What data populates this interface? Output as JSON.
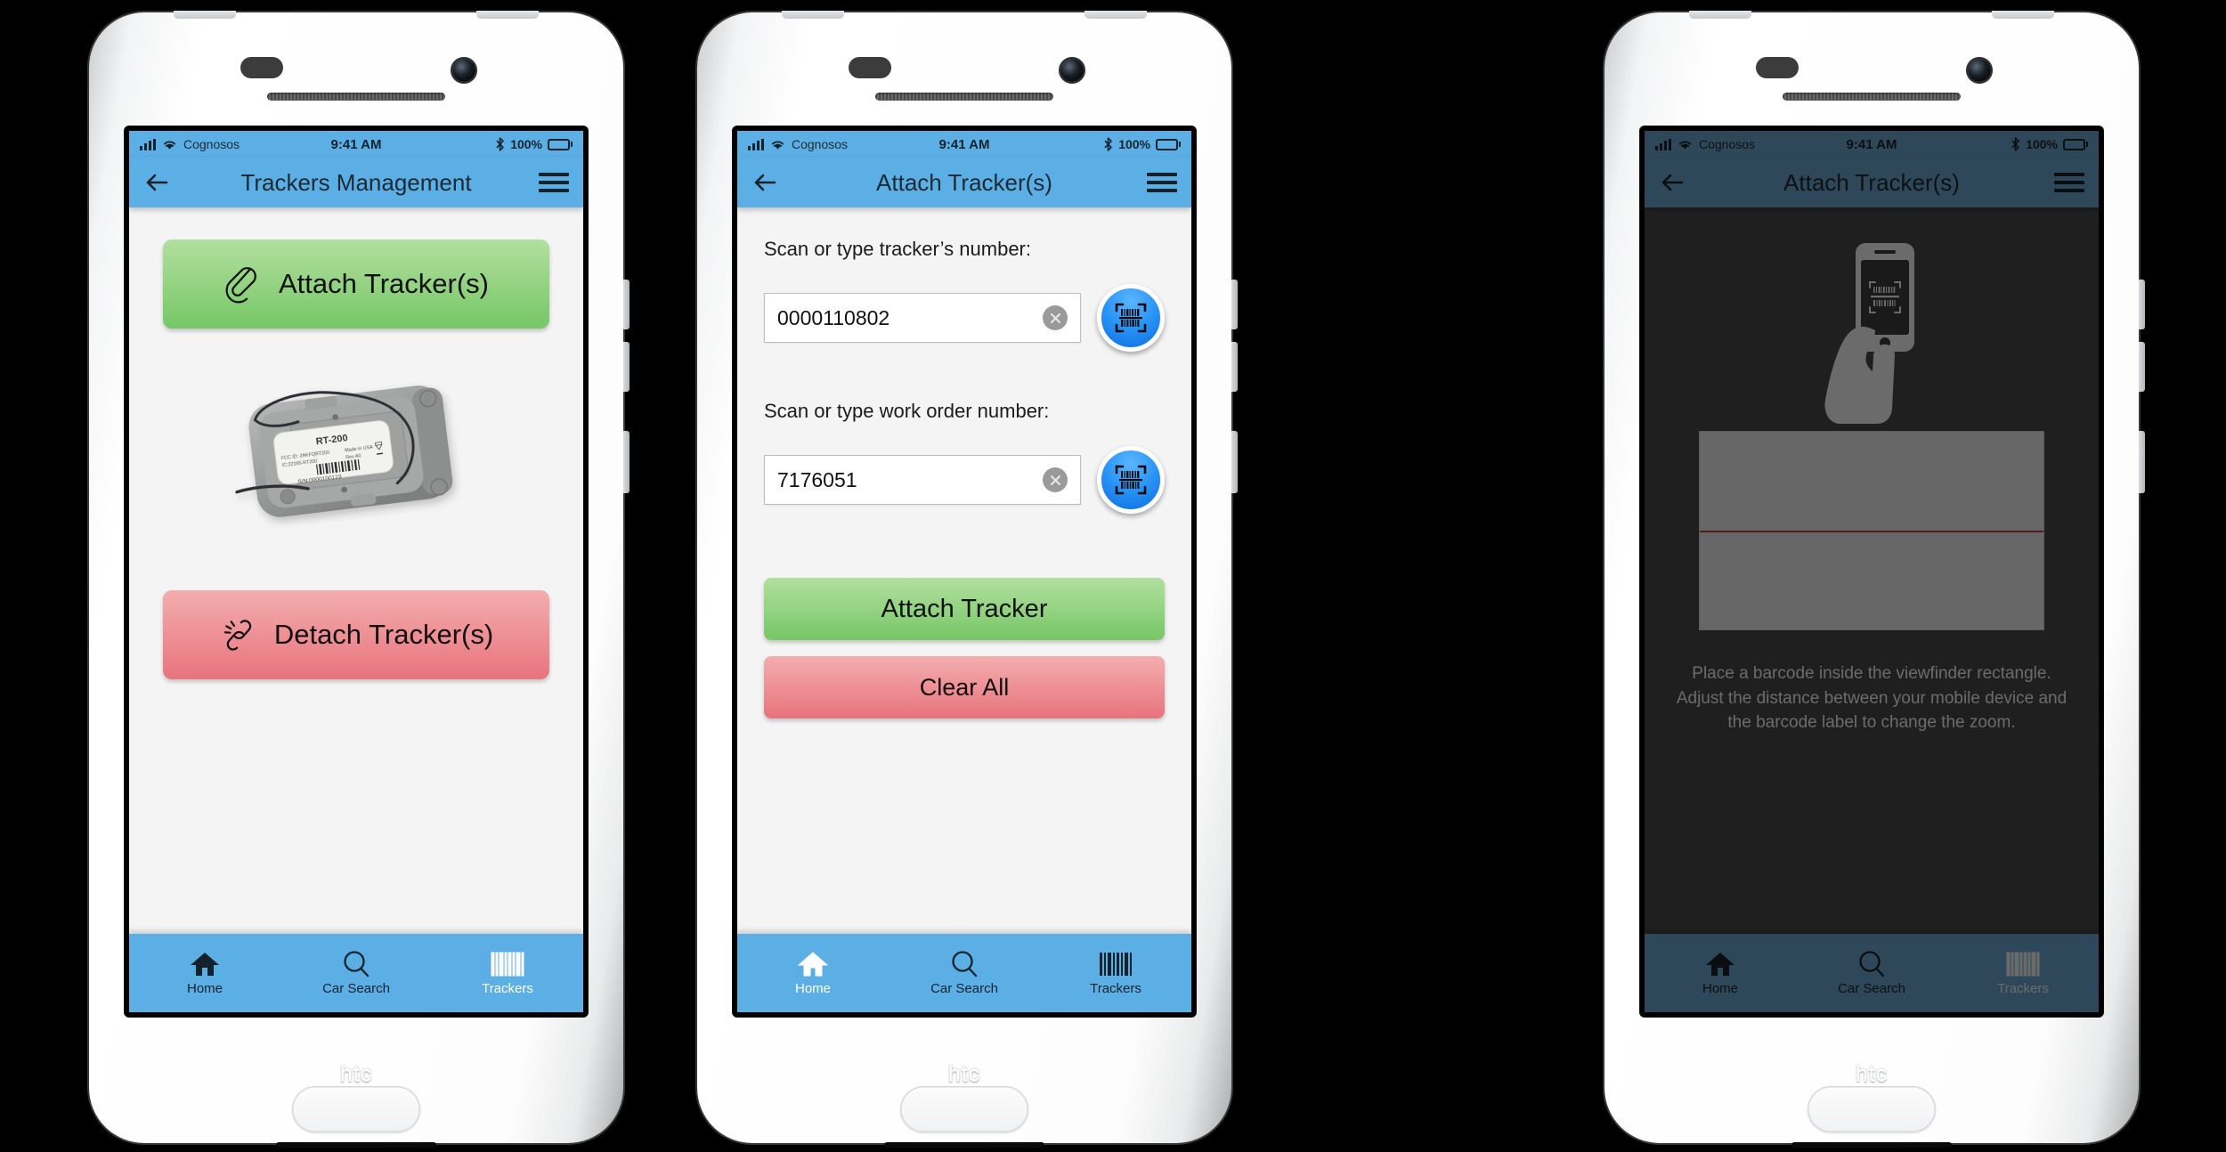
{
  "device": {
    "brand": "htc"
  },
  "status_bar": {
    "carrier": "Cognosos",
    "time": "9:41 AM",
    "battery": "100%",
    "signal_icon": "signal-bars-icon",
    "wifi_icon": "wifi-icon",
    "bluetooth_icon": "bluetooth-icon",
    "battery_icon": "battery-full-icon"
  },
  "colors": {
    "header_blue": "#5BAFE5",
    "green_top": "#b2dfa0",
    "green_bottom": "#76c765",
    "red_top": "#f3aeae",
    "red_bottom": "#e8737d",
    "scan_button_blue": "#2a94f5",
    "scan_line_red": "#e03b4b",
    "dim_overlay": "#4a4a4a"
  },
  "tabs": [
    {
      "label": "Home",
      "icon": "home-icon"
    },
    {
      "label": "Car Search",
      "icon": "magnifier-icon"
    },
    {
      "label": "Trackers",
      "icon": "barcode-icon"
    }
  ],
  "screen1": {
    "title": "Trackers Management",
    "back_icon": "back-arrow-icon",
    "menu_icon": "hamburger-menu-icon",
    "attach_button": {
      "label": "Attach Tracker(s)",
      "icon": "paperclip-icon"
    },
    "detach_button": {
      "label": "Detach Tracker(s)",
      "icon": "broken-link-icon"
    },
    "device_image": {
      "name": "rt-200-tracker-photo",
      "model": "RT-200",
      "fcc_id": "FCC ID: 2AKFQRT200",
      "ic_id": "IC:22165-RT200",
      "origin": "Made in USA",
      "revision": "Rev A0",
      "serial": "S/N:0000100123"
    },
    "active_tab": 2
  },
  "screen2": {
    "title": "Attach Tracker(s)",
    "back_icon": "back-arrow-icon",
    "menu_icon": "hamburger-menu-icon",
    "tracker_field": {
      "label": "Scan or type tracker’s number:",
      "value": "0000110802",
      "clear_icon": "clear-circle-icon",
      "scan_icon": "barcode-scan-icon"
    },
    "workorder_field": {
      "label": "Scan or type work order number:",
      "value": "7176051",
      "clear_icon": "clear-circle-icon",
      "scan_icon": "barcode-scan-icon"
    },
    "attach_button": {
      "label": "Attach Tracker"
    },
    "clear_button": {
      "label": "Clear All"
    },
    "active_tab": 0
  },
  "screen3": {
    "title": "Attach Tracker(s)",
    "back_icon": "back-arrow-icon",
    "menu_icon": "hamburger-menu-icon",
    "hand_icon": "hand-holding-phone-scanning-icon",
    "viewfinder": {
      "name": "barcode-viewfinder",
      "scan_line": "red-scan-line"
    },
    "help_text": "Place a barcode inside the viewfinder rectangle. Adjust the distance between your mobile device and the barcode label to change the zoom.",
    "active_tab": null
  }
}
